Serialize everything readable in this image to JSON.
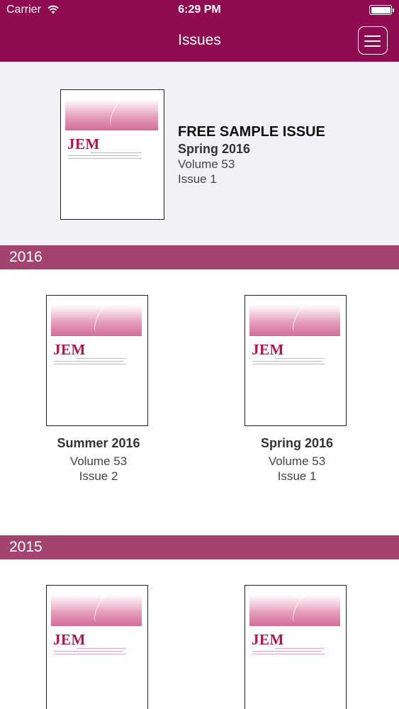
{
  "status_bar": {
    "carrier": "Carrier",
    "time": "6:29 PM"
  },
  "nav": {
    "title": "Issues",
    "menu_icon": "hamburger-menu-icon"
  },
  "featured": {
    "label": "FREE SAMPLE ISSUE",
    "season": "Spring 2016",
    "volume": "Volume 53",
    "issue": "Issue 1",
    "cover_logo": "JEM"
  },
  "sections": [
    {
      "year": "2016",
      "issues": [
        {
          "season": "Summer 2016",
          "volume": "Volume 53",
          "issue": "Issue 2",
          "cover_logo": "JEM"
        },
        {
          "season": "Spring 2016",
          "volume": "Volume 53",
          "issue": "Issue 1",
          "cover_logo": "JEM"
        }
      ]
    },
    {
      "year": "2015",
      "issues": [
        {
          "cover_logo": "JEM"
        },
        {
          "cover_logo": "JEM"
        }
      ]
    }
  ],
  "colors": {
    "nav_bar": "#8e0c4f",
    "year_bar": "#a2446f",
    "featured_bg": "#f2f2f6",
    "logo": "#b3104f"
  }
}
